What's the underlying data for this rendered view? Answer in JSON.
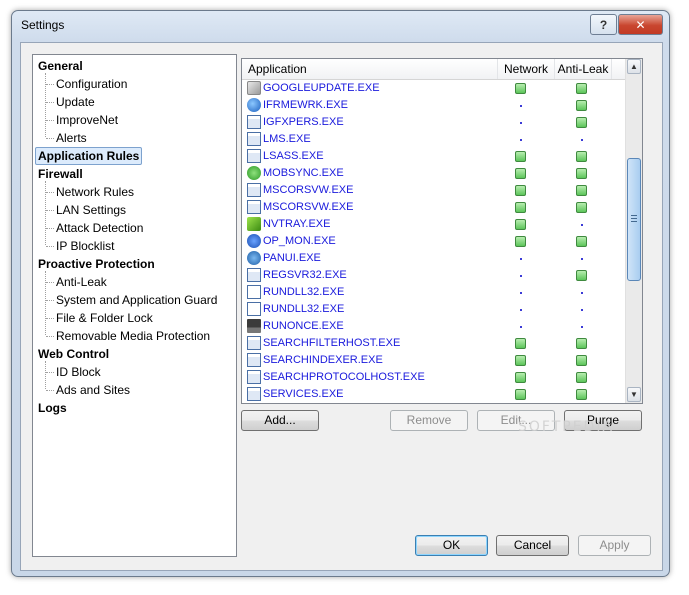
{
  "window": {
    "title": "Settings",
    "help_label": "?",
    "close_label": "✕"
  },
  "tree": {
    "categories": [
      {
        "label": "General",
        "children": [
          "Configuration",
          "Update",
          "ImproveNet",
          "Alerts"
        ]
      },
      {
        "label": "Application Rules",
        "children": []
      },
      {
        "label": "Firewall",
        "children": [
          "Network Rules",
          "LAN Settings",
          "Attack Detection",
          "IP Blocklist"
        ]
      },
      {
        "label": "Proactive Protection",
        "children": [
          "Anti-Leak",
          "System and Application Guard",
          "File & Folder Lock",
          "Removable Media Protection"
        ]
      },
      {
        "label": "Web Control",
        "children": [
          "ID Block",
          "Ads and Sites"
        ]
      },
      {
        "label": "Logs",
        "children": []
      }
    ],
    "selected": "Application Rules"
  },
  "list": {
    "columns": [
      "Application",
      "Network",
      "Anti-Leak"
    ],
    "rows": [
      {
        "name": "GOOGLEUPDATE.EXE",
        "icon": "google-update-icon",
        "network": "allow",
        "antileak": "allow"
      },
      {
        "name": "IFRMEWRK.EXE",
        "icon": "wifi-globe-icon",
        "network": "none",
        "antileak": "allow"
      },
      {
        "name": "IGFXPERS.EXE",
        "icon": "window-icon",
        "network": "none",
        "antileak": "allow"
      },
      {
        "name": "LMS.EXE",
        "icon": "window-icon",
        "network": "none",
        "antileak": "none"
      },
      {
        "name": "LSASS.EXE",
        "icon": "window-icon",
        "network": "allow",
        "antileak": "allow"
      },
      {
        "name": "MOBSYNC.EXE",
        "icon": "sync-icon",
        "network": "allow",
        "antileak": "allow"
      },
      {
        "name": "MSCORSVW.EXE",
        "icon": "window-icon",
        "network": "allow",
        "antileak": "allow"
      },
      {
        "name": "MSCORSVW.EXE",
        "icon": "window-icon",
        "network": "allow",
        "antileak": "allow"
      },
      {
        "name": "NVTRAY.EXE",
        "icon": "nvidia-icon",
        "network": "allow",
        "antileak": "none"
      },
      {
        "name": "OP_MON.EXE",
        "icon": "op-monitor-icon",
        "network": "allow",
        "antileak": "allow"
      },
      {
        "name": "PANUI.EXE",
        "icon": "panda-icon",
        "network": "none",
        "antileak": "none"
      },
      {
        "name": "REGSVR32.EXE",
        "icon": "window-icon",
        "network": "none",
        "antileak": "allow"
      },
      {
        "name": "RUNDLL32.EXE",
        "icon": "document-icon",
        "network": "none",
        "antileak": "none"
      },
      {
        "name": "RUNDLL32.EXE",
        "icon": "document-icon",
        "network": "none",
        "antileak": "none"
      },
      {
        "name": "RUNONCE.EXE",
        "icon": "computer-icon",
        "network": "none",
        "antileak": "none"
      },
      {
        "name": "SEARCHFILTERHOST.EXE",
        "icon": "window-icon",
        "network": "allow",
        "antileak": "allow"
      },
      {
        "name": "SEARCHINDEXER.EXE",
        "icon": "window-icon",
        "network": "allow",
        "antileak": "allow"
      },
      {
        "name": "SEARCHPROTOCOLHOST.EXE",
        "icon": "window-icon",
        "network": "allow",
        "antileak": "allow"
      },
      {
        "name": "SERVICES.EXE",
        "icon": "window-icon",
        "network": "allow",
        "antileak": "allow"
      }
    ]
  },
  "list_buttons": {
    "add": "Add...",
    "remove": "Remove",
    "edit": "Edit...",
    "purge": "Purge"
  },
  "dialog_buttons": {
    "ok": "OK",
    "cancel": "Cancel",
    "apply": "Apply"
  },
  "watermark": "SOFTPEDIA",
  "colors": {
    "allow": "#5cc55a",
    "link": "#1a1adc",
    "selection": "#dcebfc"
  }
}
